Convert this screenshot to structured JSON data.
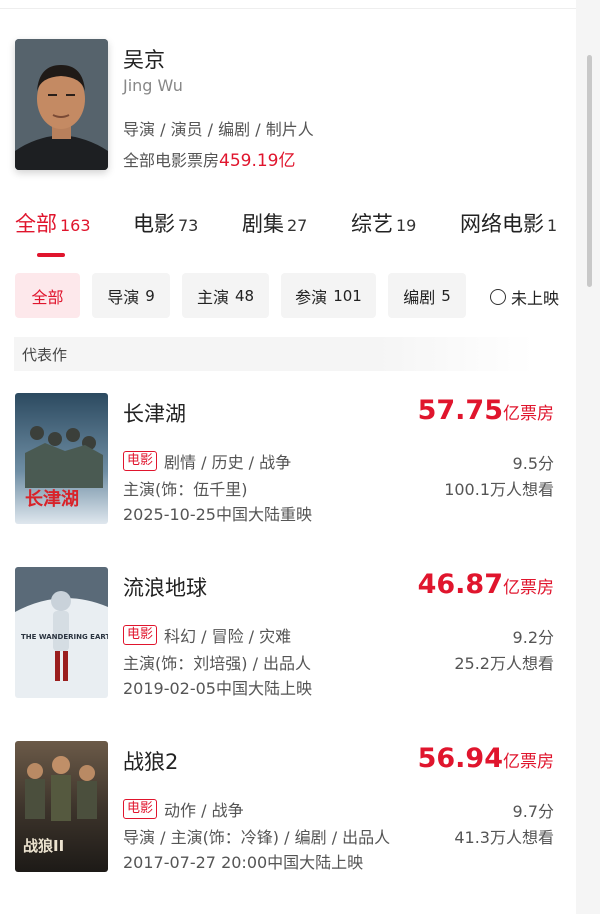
{
  "profile": {
    "name": "吴京",
    "english_name": "Jing Wu",
    "roles": "导演 / 演员 / 编剧 / 制片人",
    "boxoffice_label": "全部电影票房",
    "boxoffice_value": "459.19亿"
  },
  "tabs": [
    {
      "label": "全部",
      "count": "163",
      "active": true
    },
    {
      "label": "电影",
      "count": "73"
    },
    {
      "label": "剧集",
      "count": "27"
    },
    {
      "label": "综艺",
      "count": "19"
    },
    {
      "label": "网络电影",
      "count": "1"
    }
  ],
  "filters": [
    {
      "label": "全部",
      "count": "",
      "active": true
    },
    {
      "label": "导演",
      "count": "9"
    },
    {
      "label": "主演",
      "count": "48"
    },
    {
      "label": "参演",
      "count": "101"
    },
    {
      "label": "编剧",
      "count": "5"
    }
  ],
  "unreleased_label": "未上映",
  "section_label": "代表作",
  "movies": [
    {
      "title": "长津湖",
      "boxoffice_num": "57.75",
      "boxoffice_unit": "亿票房",
      "tag": "电影",
      "genres": "剧情 / 历史 / 战争",
      "role": "主演(饰：伍千里)",
      "release": "2025-10-25中国大陆重映",
      "score": "9.5分",
      "want": "100.1万人想看",
      "poster_text": "长津湖"
    },
    {
      "title": "流浪地球",
      "boxoffice_num": "46.87",
      "boxoffice_unit": "亿票房",
      "tag": "电影",
      "genres": "科幻 / 冒险 / 灾难",
      "role": "主演(饰：刘培强)  / 出品人",
      "release": "2019-02-05中国大陆上映",
      "score": "9.2分",
      "want": "25.2万人想看",
      "poster_text": "THE WANDERING EARTH"
    },
    {
      "title": "战狼2",
      "boxoffice_num": "56.94",
      "boxoffice_unit": "亿票房",
      "tag": "电影",
      "genres": "动作 / 战争",
      "role": "导演 / 主演(饰：冷锋)  / 编剧 / 出品人",
      "release": "2017-07-27 20:00中国大陆上映",
      "score": "9.7分",
      "want": "41.3万人想看",
      "poster_text": "战狼II"
    }
  ],
  "colors": {
    "accent": "#e0152d",
    "chip_bg": "#f4f4f4",
    "chip_active_bg": "#fde8eb"
  }
}
